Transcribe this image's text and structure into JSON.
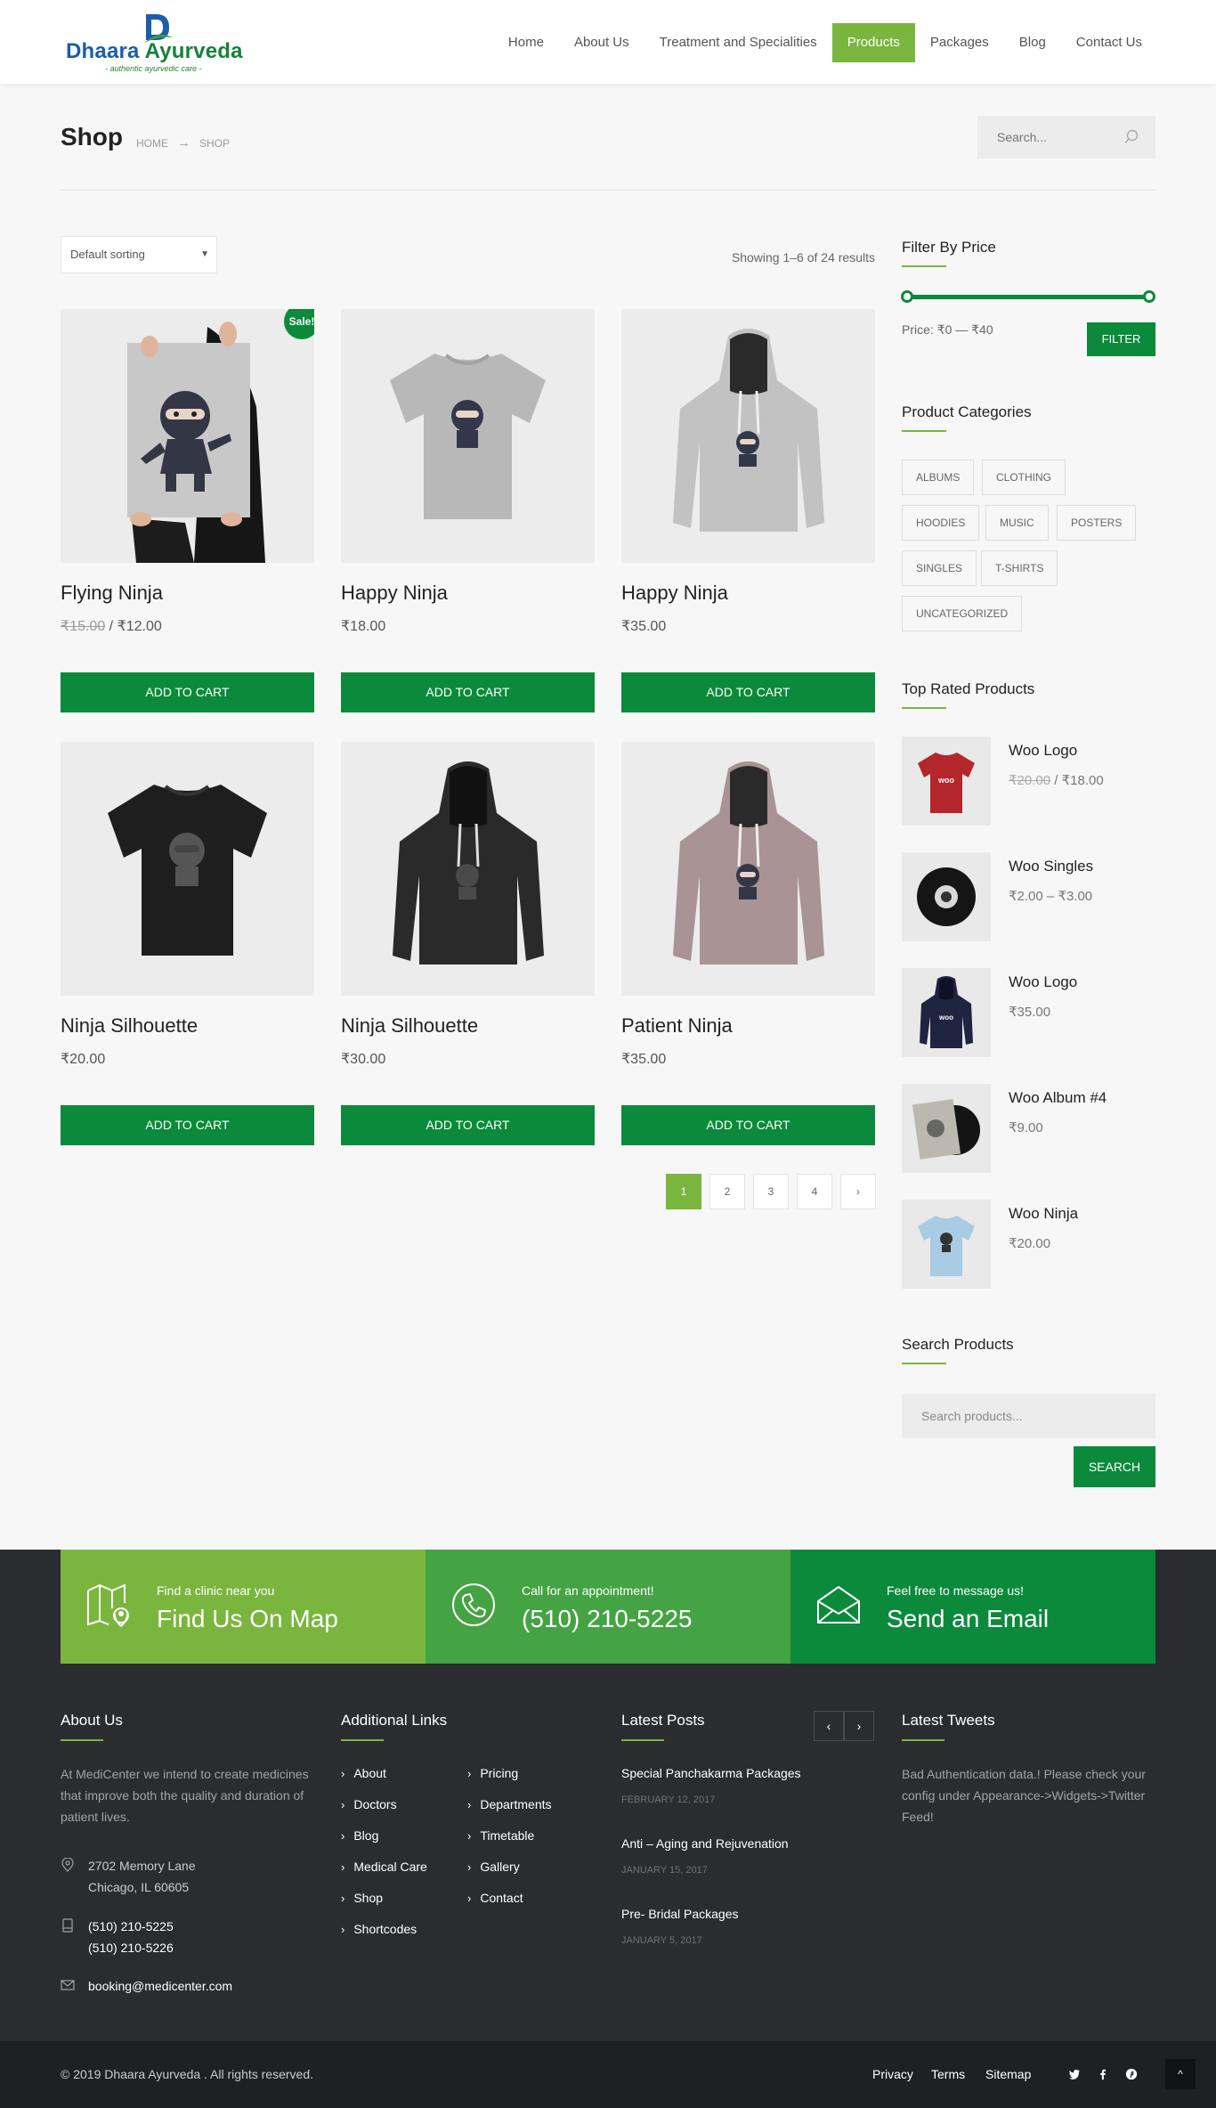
{
  "header": {
    "brand_name_1": "Dhaara",
    "brand_name_2": "Ayurveda",
    "brand_tagline": "- authentic ayurvedic care -",
    "brand_colors": {
      "blue": "#1b5ea8",
      "green": "#188038"
    },
    "nav": [
      "Home",
      "About Us",
      "Treatment and Specialities",
      "Products",
      "Packages",
      "Blog",
      "Contact Us"
    ],
    "nav_active": "Products",
    "accent_color": "#7ab63e"
  },
  "title_bar": {
    "title": "Shop",
    "breadcrumb": [
      "HOME",
      "SHOP"
    ],
    "search_placeholder": "Search..."
  },
  "shop": {
    "sorting_value": "Default sorting",
    "result_count": "Showing 1–6 of 24 results",
    "button_color": "#0b8a3b",
    "add_to_cart_label": "ADD TO CART",
    "sale_badge": "Sale!",
    "products": [
      {
        "name": "Flying Ninja",
        "old_price": "₹15.00",
        "price": "₹12.00",
        "image": "poster-icon"
      },
      {
        "name": "Happy Ninja",
        "price": "₹18.00",
        "image": "tshirt-grey-icon"
      },
      {
        "name": "Happy Ninja",
        "price": "₹35.00",
        "image": "hoodie-grey-icon"
      },
      {
        "name": "Ninja Silhouette",
        "price": "₹20.00",
        "image": "tshirt-black-icon"
      },
      {
        "name": "Ninja Silhouette",
        "price": "₹30.00",
        "image": "hoodie-black-icon"
      },
      {
        "name": "Patient Ninja",
        "price": "₹35.00",
        "image": "hoodie-pink-icon"
      }
    ],
    "pagination": [
      "1",
      "2",
      "3",
      "4",
      "›"
    ],
    "current_page": "1"
  },
  "sidebar": {
    "filter_title": "Filter By Price",
    "price_label": "Price: ₹0 — ₹40",
    "filter_button": "FILTER",
    "categories_title": "Product Categories",
    "categories": [
      "ALBUMS",
      "CLOTHING",
      "HOODIES",
      "MUSIC",
      "POSTERS",
      "SINGLES",
      "T-SHIRTS",
      "UNCATEGORIZED"
    ],
    "top_rated_title": "Top Rated Products",
    "top_rated": [
      {
        "name": "Woo Logo",
        "old_price": "₹20.00",
        "price": "₹18.00",
        "image": "red-tshirt-icon"
      },
      {
        "name": "Woo Singles",
        "price": "₹2.00 – ₹3.00",
        "image": "vinyl-icon"
      },
      {
        "name": "Woo Logo",
        "price": "₹35.00",
        "image": "navy-hoodie-icon"
      },
      {
        "name": "Woo Album #4",
        "price": "₹9.00",
        "image": "album-icon"
      },
      {
        "name": "Woo Ninja",
        "price": "₹20.00",
        "image": "light-blue-tshirt-icon"
      }
    ],
    "search_title": "Search Products",
    "search_placeholder": "Search products...",
    "search_button": "SEARCH"
  },
  "cta": [
    {
      "small": "Find a clinic near you",
      "big": "Find Us On Map",
      "icon": "map-icon",
      "color": "#7ab63e"
    },
    {
      "small": "Call for an appointment!",
      "big": "(510) 210-5225",
      "icon": "phone-icon",
      "color": "#44a342"
    },
    {
      "small": "Feel free to message us!",
      "big": "Send an Email",
      "icon": "envelope-icon",
      "color": "#0b8a3b"
    }
  ],
  "footer": {
    "about_title": "About Us",
    "about_text": "At MediCenter we intend to create medicines that improve both the quality and duration of patient lives.",
    "address_1": "2702 Memory Lane",
    "address_2": "Chicago, IL 60605",
    "phone_1": "(510) 210-5225",
    "phone_2": "(510) 210-5226",
    "email": "booking@medicenter.com",
    "links_title": "Additional Links",
    "links_col1": [
      "About",
      "Doctors",
      "Blog",
      "Medical Care",
      "Shop",
      "Shortcodes"
    ],
    "links_col2": [
      "Pricing",
      "Departments",
      "Timetable",
      "Gallery",
      "Contact"
    ],
    "posts_title": "Latest Posts",
    "posts": [
      {
        "title": "Special Panchakarma Packages",
        "date": "FEBRUARY 12, 2017"
      },
      {
        "title": "Anti – Aging and Rejuvenation",
        "date": "JANUARY 15, 2017"
      },
      {
        "title": "Pre- Bridal Packages",
        "date": "JANUARY 5, 2017"
      }
    ],
    "tweets_title": "Latest Tweets",
    "tweet_text": "Bad Authentication data.! Please check your config under Appearance->Widgets->Twitter Feed!",
    "copyright": "© 2019 Dhaara Ayurveda . All rights reserved.",
    "bottom_links": [
      "Privacy",
      "Terms",
      "Sitemap"
    ],
    "social": [
      "twitter-icon",
      "facebook-icon",
      "pinterest-icon"
    ],
    "to_top": "^"
  }
}
